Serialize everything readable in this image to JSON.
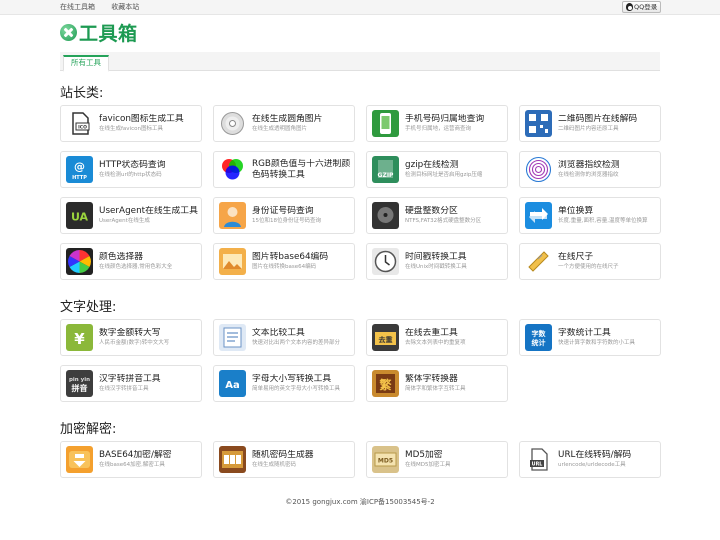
{
  "topbar": {
    "links": [
      "在线工具箱",
      "收藏本站"
    ],
    "qq_login": "QQ登录"
  },
  "logo": {
    "text": "工具箱"
  },
  "tabs": [
    "所有工具"
  ],
  "sections": [
    {
      "title": "站长类:",
      "tools": [
        {
          "name": "favicon图标生成工具",
          "desc": "在线生成favicon图标工具",
          "icon": "favicon-icon",
          "color": "#ffffff"
        },
        {
          "name": "在线生成圆角图片",
          "desc": "在线生成透明圆角图片",
          "icon": "cd-disc-icon",
          "color": "#ffffff"
        },
        {
          "name": "手机号码归属地查询",
          "desc": "手机号归属地，运营商查询",
          "icon": "phone-icon",
          "color": "#2f9a3e"
        },
        {
          "name": "二维码图片在线解码",
          "desc": "二维码图片内容还原工具",
          "icon": "qrcode-icon",
          "color": "#2d6cb8"
        },
        {
          "name": "HTTP状态码查询",
          "desc": "在线检测url的http状态码",
          "icon": "http-icon",
          "color": "#1a8bd6"
        },
        {
          "name": "RGB颜色值与十六进制颜色码转换工具",
          "desc": "",
          "icon": "rgb-circles-icon",
          "color": "#ffffff"
        },
        {
          "name": "gzip在线检测",
          "desc": "检测目标网址是否启用gzip压缩",
          "icon": "gzip-icon",
          "color": "#2e8e5c"
        },
        {
          "name": "浏览器指纹检测",
          "desc": "在线检测你的浏览器指纹",
          "icon": "fingerprint-icon",
          "color": "#ffffff"
        },
        {
          "name": "UserAgent在线生成工具",
          "desc": "UserAgent在线生成",
          "icon": "ua-icon",
          "color": "#2b2b2b"
        },
        {
          "name": "身份证号码查询",
          "desc": "15位和18位身份证号码查询",
          "icon": "id-card-icon",
          "color": "#f6a548"
        },
        {
          "name": "硬盘整数分区",
          "desc": "NTFS,FAT32格式硬盘整数分区",
          "icon": "hard-disk-icon",
          "color": "#333333"
        },
        {
          "name": "单位换算",
          "desc": "长度,重量,面积,容量,温度等单位换算",
          "icon": "convert-arrows-icon",
          "color": "#1b8de0"
        },
        {
          "name": "颜色选择器",
          "desc": "在线颜色选择器,常用色彩大全",
          "icon": "color-wheel-icon",
          "color": "#222222"
        },
        {
          "name": "图片转base64编码",
          "desc": "图片在线转换base64编码",
          "icon": "image-icon",
          "color": "#f3b04a"
        },
        {
          "name": "时间戳转换工具",
          "desc": "在线Unix时间戳转换工具",
          "icon": "clock-icon",
          "color": "#e8e8e8"
        },
        {
          "name": "在线尺子",
          "desc": "一个方便使用的在线尺子",
          "icon": "ruler-icon",
          "color": "#ffffff"
        }
      ]
    },
    {
      "title": "文字处理:",
      "tools": [
        {
          "name": "数字金额转大写",
          "desc": "人民币金额(数字)转中文大写",
          "icon": "yuan-icon",
          "color": "#8bb83a"
        },
        {
          "name": "文本比较工具",
          "desc": "快速对比出两个文本内容的差异部分",
          "icon": "text-compare-icon",
          "color": "#dfe9f5"
        },
        {
          "name": "在线去重工具",
          "desc": "去除文本列表中的重复项",
          "icon": "dedupe-icon",
          "color": "#3a3a3a"
        },
        {
          "name": "字数统计工具",
          "desc": "快速计算字数和字符数的小工具",
          "icon": "word-count-icon",
          "color": "#1574c4"
        },
        {
          "name": "汉字转拼音工具",
          "desc": "在线汉字转拼音工具",
          "icon": "pinyin-icon",
          "color": "#3d3d3d"
        },
        {
          "name": "字母大小写转换工具",
          "desc": "简单易用的英文字母大小写转换工具",
          "icon": "letter-case-icon",
          "color": "#1a7fc9"
        },
        {
          "name": "繁体字转换器",
          "desc": "简体字和繁体字互转工具",
          "icon": "traditional-char-icon",
          "color": "#c98a2e"
        }
      ]
    },
    {
      "title": "加密解密:",
      "tools": [
        {
          "name": "BASE64加密/解密",
          "desc": "在线base64加密,解密工具",
          "icon": "download-cloud-icon",
          "color": "#f4a02e"
        },
        {
          "name": "随机密码生成器",
          "desc": "在线生成随机密码",
          "icon": "slot-machine-icon",
          "color": "#8a4a1e"
        },
        {
          "name": "MD5加密",
          "desc": "在线MD5加密工具",
          "icon": "md5-icon",
          "color": "#d9c28a"
        },
        {
          "name": "URL在线转码/解码",
          "desc": "urlencode/urldecode工具",
          "icon": "url-file-icon",
          "color": "#ffffff"
        }
      ]
    }
  ],
  "footer": "©2015 gongjux.com 渝ICP备15003545号-2"
}
